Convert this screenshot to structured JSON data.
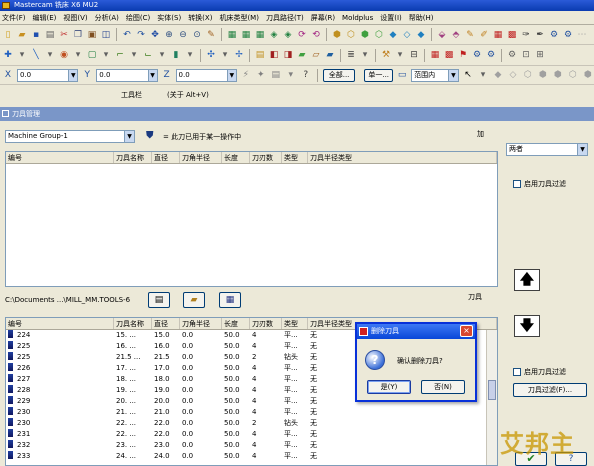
{
  "window": {
    "title": "Mastercam 铣床 X6 MU2"
  },
  "menu": [
    "文件(F)",
    "编辑(E)",
    "视图(V)",
    "分析(A)",
    "绘图(C)",
    "实体(S)",
    "转换(X)",
    "机床类型(M)",
    "刀具路径(T)",
    "屏幕(R)",
    "Moldplus",
    "设置(I)",
    "帮助(H)"
  ],
  "statusbar": {
    "x_value": "0.0",
    "y_value": "0.0",
    "z_value": "0.0",
    "all_label": "全部...",
    "single_label": "单一...",
    "range_label": "范围内"
  },
  "toolbar_hint": {
    "name": "工具栏",
    "shortcut": "(关于 Alt+V)"
  },
  "panel": {
    "title": "刀具管理"
  },
  "machine_group": {
    "value": "Machine Group-1",
    "note": "= 此刀已用于某一操作中"
  },
  "filter_label": "加",
  "both_label": "两者",
  "columns": [
    "编号",
    "刀具名称",
    "直径",
    "刀角半径",
    "长度",
    "刀刃数",
    "类型",
    "刀具半径类型"
  ],
  "library": {
    "path": "C:\\Documents ...\\MILL_MM.TOOLS-6",
    "label": "刀具",
    "rows": [
      {
        "num": "224",
        "name": "15. ...",
        "dia": "15.0",
        "rad": "0.0",
        "len": "50.0",
        "flutes": "4",
        "type": "平...",
        "radtype": "无"
      },
      {
        "num": "225",
        "name": "16. ...",
        "dia": "16.0",
        "rad": "0.0",
        "len": "50.0",
        "flutes": "4",
        "type": "平...",
        "radtype": "无"
      },
      {
        "num": "225",
        "name": "21.5 ...",
        "dia": "21.5",
        "rad": "0.0",
        "len": "50.0",
        "flutes": "2",
        "type": "钻头",
        "radtype": "无"
      },
      {
        "num": "226",
        "name": "17. ...",
        "dia": "17.0",
        "rad": "0.0",
        "len": "50.0",
        "flutes": "4",
        "type": "平...",
        "radtype": "无"
      },
      {
        "num": "227",
        "name": "18. ...",
        "dia": "18.0",
        "rad": "0.0",
        "len": "50.0",
        "flutes": "4",
        "type": "平...",
        "radtype": "无"
      },
      {
        "num": "228",
        "name": "19. ...",
        "dia": "19.0",
        "rad": "0.0",
        "len": "50.0",
        "flutes": "4",
        "type": "平...",
        "radtype": "无"
      },
      {
        "num": "229",
        "name": "20. ...",
        "dia": "20.0",
        "rad": "0.0",
        "len": "50.0",
        "flutes": "4",
        "type": "平...",
        "radtype": "无"
      },
      {
        "num": "230",
        "name": "21. ...",
        "dia": "21.0",
        "rad": "0.0",
        "len": "50.0",
        "flutes": "4",
        "type": "平...",
        "radtype": "无"
      },
      {
        "num": "230",
        "name": "22. ...",
        "dia": "22.0",
        "rad": "0.0",
        "len": "50.0",
        "flutes": "2",
        "type": "钻头",
        "radtype": "无"
      },
      {
        "num": "231",
        "name": "22. ...",
        "dia": "22.0",
        "rad": "0.0",
        "len": "50.0",
        "flutes": "4",
        "type": "平...",
        "radtype": "无"
      },
      {
        "num": "232",
        "name": "23. ...",
        "dia": "23.0",
        "rad": "0.0",
        "len": "50.0",
        "flutes": "4",
        "type": "平...",
        "radtype": "无"
      },
      {
        "num": "233",
        "name": "24. ...",
        "dia": "24.0",
        "rad": "0.0",
        "len": "50.0",
        "flutes": "4",
        "type": "平...",
        "radtype": "无"
      }
    ]
  },
  "enable_filter_label": "启用刀具过滤",
  "filter_button": "刀具过滤(F)...",
  "dialog": {
    "title": "删除刀具",
    "message": "确认删除刀具?",
    "yes": "是(Y)",
    "no": "否(N)",
    "close": "×"
  },
  "watermark": "艾邦主"
}
